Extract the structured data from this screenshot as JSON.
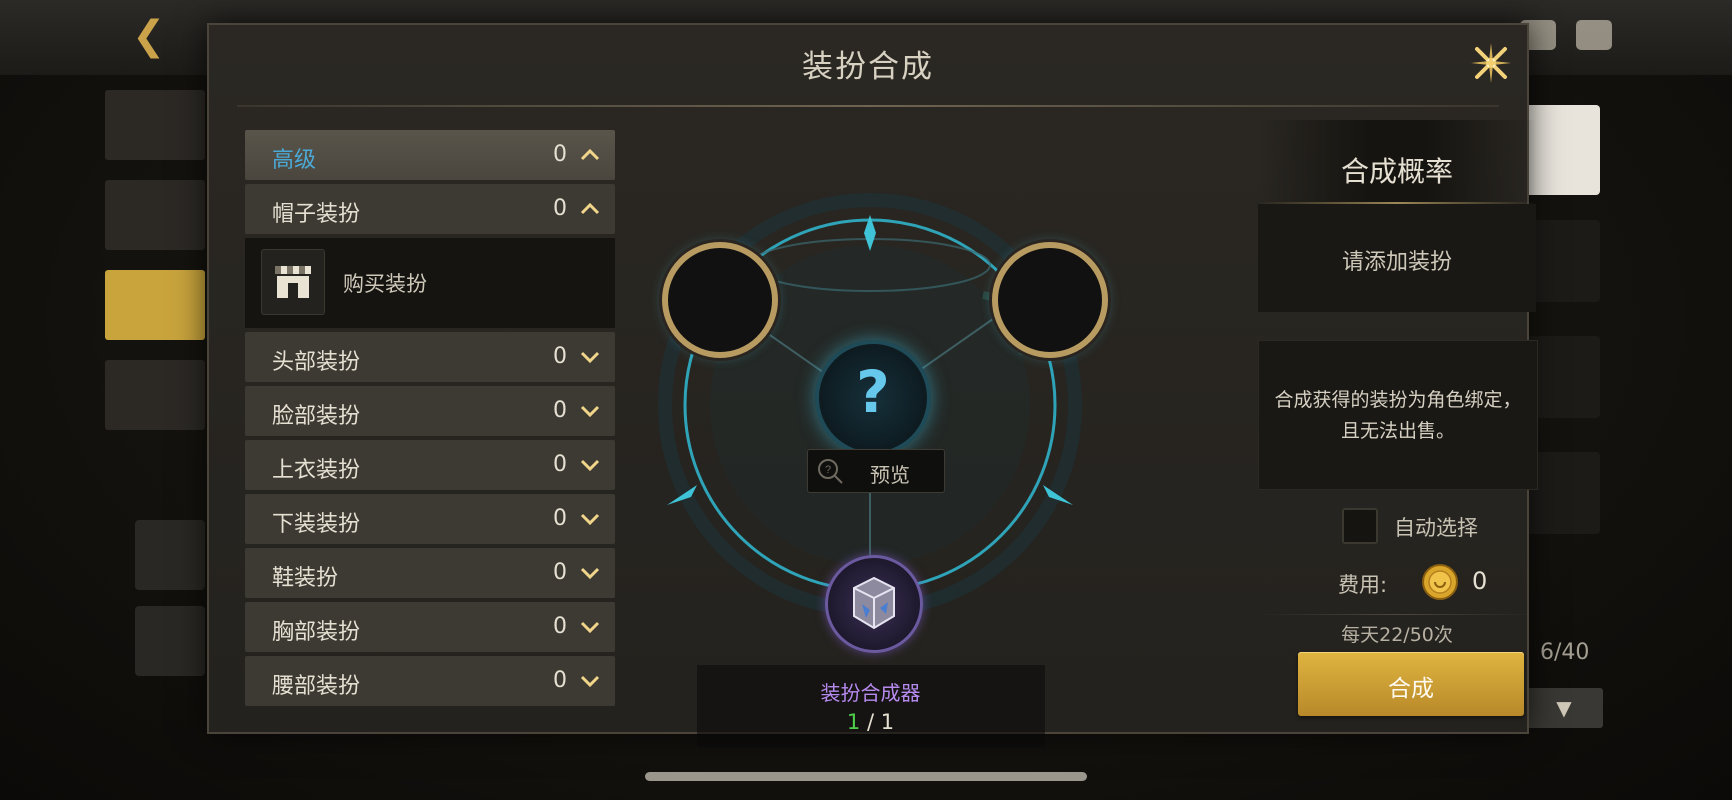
{
  "background": {
    "top_icon_names": [
      "mail-icon",
      "chat-icon"
    ],
    "nav_items": [
      "",
      "",
      "",
      ""
    ],
    "slot_count": "6/40"
  },
  "modal": {
    "title": "装扮合成",
    "categories": [
      {
        "label": "高级",
        "count": "0",
        "state": "expanded"
      },
      {
        "label": "帽子装扮",
        "count": "0",
        "state": "expanded"
      },
      {
        "label": "头部装扮",
        "count": "0",
        "state": "collapsed"
      },
      {
        "label": "脸部装扮",
        "count": "0",
        "state": "collapsed"
      },
      {
        "label": "上衣装扮",
        "count": "0",
        "state": "collapsed"
      },
      {
        "label": "下装装扮",
        "count": "0",
        "state": "collapsed"
      },
      {
        "label": "鞋装扮",
        "count": "0",
        "state": "collapsed"
      },
      {
        "label": "胸部装扮",
        "count": "0",
        "state": "collapsed"
      },
      {
        "label": "腰部装扮",
        "count": "0",
        "state": "collapsed"
      }
    ],
    "buy_item": {
      "label": "购买装扮",
      "icon": "shop-icon"
    },
    "center": {
      "question_mark": "?",
      "preview_label": "预览",
      "synth_item_name": "装扮合成器",
      "synth_have": "1",
      "synth_need": "1"
    },
    "right": {
      "rate_title": "合成概率",
      "rate_placeholder": "请添加装扮",
      "note": "合成获得的装扮为角色绑定，且无法出售。",
      "auto_select_label": "自动选择",
      "cost_label": "费用:",
      "cost_value": "0",
      "daily_limit": "每天22/50次",
      "combine_label": "合成"
    }
  },
  "colors": {
    "accent_gold": "#d4a83a",
    "highlight_blue": "#4ba9d6",
    "synth_item_purple": "#b78af0",
    "count_green": "#4fd04a"
  }
}
